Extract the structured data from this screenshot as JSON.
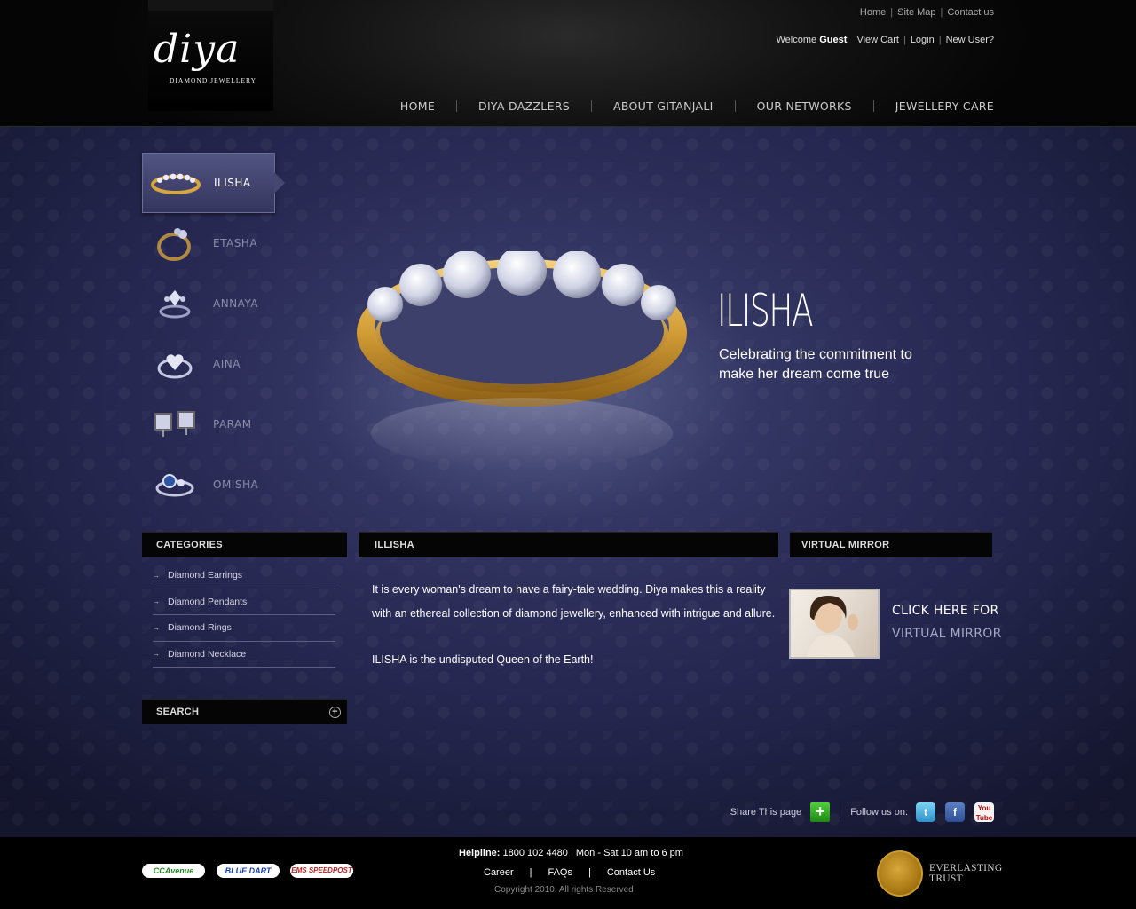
{
  "header": {
    "logo_script": "diya",
    "logo_tagline": "DIAMOND JEWELLERY",
    "top_links": [
      "Home",
      "Site Map",
      "Contact us"
    ],
    "welcome_label": "Welcome",
    "welcome_user": "Guest",
    "user_links": [
      "View Cart",
      "Login",
      "New User?"
    ],
    "nav": [
      "HOME",
      "DIYA DAZZLERS",
      "ABOUT GITANJALI",
      "OUR NETWORKS",
      "JEWELLERY CARE"
    ]
  },
  "collections": [
    {
      "label": "ILISHA",
      "icon": "gold-band-ring-icon",
      "active": true
    },
    {
      "label": "ETASHA",
      "icon": "solitaire-ring-icon",
      "active": false
    },
    {
      "label": "ANNAYA",
      "icon": "cluster-ring-icon",
      "active": false
    },
    {
      "label": "AINA",
      "icon": "heart-ring-icon",
      "active": false
    },
    {
      "label": "PARAM",
      "icon": "stud-earrings-icon",
      "active": false
    },
    {
      "label": "OMISHA",
      "icon": "sapphire-ring-icon",
      "active": false
    }
  ],
  "hero": {
    "title": "ILISHA",
    "subtitle": "Celebrating the commitment to make her dream come true"
  },
  "categories": {
    "heading": "CATEGORIES",
    "items": [
      "Diamond Earrings",
      "Diamond Pendants",
      "Diamond Rings",
      "Diamond Necklace"
    ]
  },
  "search": {
    "heading": "SEARCH"
  },
  "article": {
    "heading": "ILLISHA",
    "paragraph1": "It is every woman's dream to have a fairy-tale wedding. Diya makes this a reality with an ethereal collection of diamond jewellery, enhanced with intrigue and allure.",
    "paragraph2": "ILISHA is the undisputed Queen of the Earth!"
  },
  "virtual_mirror": {
    "heading": "VIRTUAL MIRROR",
    "line1": "CLICK HERE FOR",
    "line2": "VIRTUAL MIRROR"
  },
  "share": {
    "share_label": "Share This page",
    "follow_label": "Follow us on:",
    "twitter_glyph": "t",
    "facebook_glyph": "f",
    "youtube_top": "You",
    "youtube_bottom": "Tube"
  },
  "footer": {
    "badges": [
      "CCAvenue",
      "BLUE DART",
      "EMS SPEEDPOST"
    ],
    "helpline_label": "Helpline:",
    "helpline_value": "1800 102 4480 | Mon - Sat 10 am to 6 pm",
    "links": [
      "Career",
      "FAQs",
      "Contact Us"
    ],
    "copyright": "Copyright 2010. All rights Reserved",
    "trust_line1": "EVERLASTING",
    "trust_line2": "TRUST"
  },
  "colors": {
    "background": "#262852",
    "gold": "#d8a53e",
    "header": "#0a0a0a"
  }
}
